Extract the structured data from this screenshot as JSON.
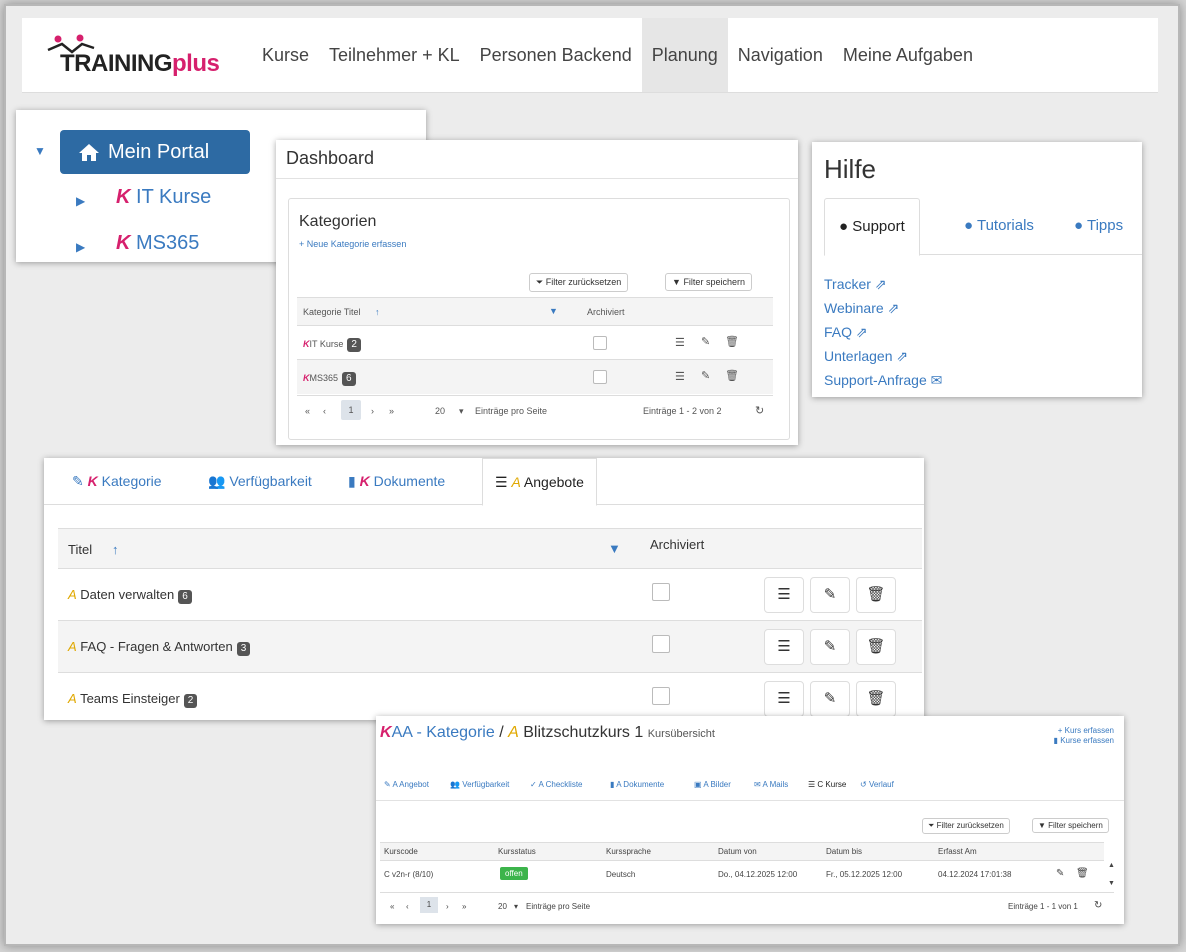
{
  "nav": {
    "logo_main": "TRAINING",
    "logo_plus": "plus",
    "items": [
      "Kurse",
      "Teilnehmer + KL",
      "Personen Backend",
      "Planung",
      "Navigation",
      "Meine Aufgaben"
    ],
    "active": "Planung"
  },
  "portal": {
    "root_label": "Mein Portal",
    "children": [
      {
        "prefix": "K",
        "label": "IT Kurse"
      },
      {
        "prefix": "K",
        "label": "MS365"
      }
    ]
  },
  "dashboard": {
    "title": "Dashboard",
    "section_title": "Kategorien",
    "new_link": "+ Neue Kategorie erfassen",
    "filter_reset": "Filter zurücksetzen",
    "filter_save": "Filter speichern",
    "col_title": "Kategorie Titel",
    "col_sort": "↑",
    "col_archived": "Archiviert",
    "rows": [
      {
        "prefix": "K",
        "label": "IT Kurse",
        "count": "2"
      },
      {
        "prefix": "K",
        "label": "MS365",
        "count": "6"
      }
    ],
    "pager": {
      "page": "1",
      "per_page": "20",
      "per_page_label": "Einträge pro Seite",
      "summary": "Einträge 1 - 2 von 2"
    }
  },
  "help": {
    "title": "Hilfe",
    "tabs": [
      "Support",
      "Tutorials",
      "Tipps"
    ],
    "links": [
      "Tracker",
      "Webinare",
      "FAQ",
      "Unterlagen",
      "Support-Anfrage"
    ]
  },
  "angebote": {
    "tabs": [
      {
        "prefix": "K",
        "label": "Kategorie"
      },
      {
        "prefix": "",
        "label": "Verfügbarkeit"
      },
      {
        "prefix": "K",
        "label": "Dokumente"
      },
      {
        "prefix": "A",
        "label": "Angebote"
      }
    ],
    "col_title": "Titel",
    "col_sort": "↑",
    "col_archived": "Archiviert",
    "rows": [
      {
        "prefix": "A",
        "label": "Daten verwalten",
        "count": "6"
      },
      {
        "prefix": "A",
        "label": "FAQ - Fragen & Antworten",
        "count": "3"
      },
      {
        "prefix": "A",
        "label": "Teams Einsteiger",
        "count": "2"
      }
    ]
  },
  "kurs": {
    "crumb_k": "K",
    "crumb_cat": "AA - Kategorie",
    "crumb_sep": "/",
    "crumb_a": "A",
    "crumb_kurs": "Blitzschutzkurs 1",
    "crumb_sub": "Kursübersicht",
    "action_new": "+ Kurs erfassen",
    "action_list": "Kurse erfassen",
    "tabs": [
      "A Angebot",
      "Verfügbarkeit",
      "A Checkliste",
      "A Dokumente",
      "A Bilder",
      "A Mails",
      "C Kurse",
      "Verlauf"
    ],
    "filter_reset": "Filter zurücksetzen",
    "filter_save": "Filter speichern",
    "columns": [
      "Kurscode",
      "Kursstatus",
      "Kurssprache",
      "Datum von",
      "Datum bis",
      "Erfasst Am"
    ],
    "row": {
      "code": "C v2n-r (8/10)",
      "status": "offen",
      "lang": "Deutsch",
      "from": "Do., 04.12.2025 12:00",
      "to": "Fr., 05.12.2025 12:00",
      "created": "04.12.2024 17:01:38"
    },
    "pager": {
      "page": "1",
      "per_page": "20",
      "per_page_label": "Einträge pro Seite",
      "summary": "Einträge 1 - 1 von 1"
    }
  }
}
